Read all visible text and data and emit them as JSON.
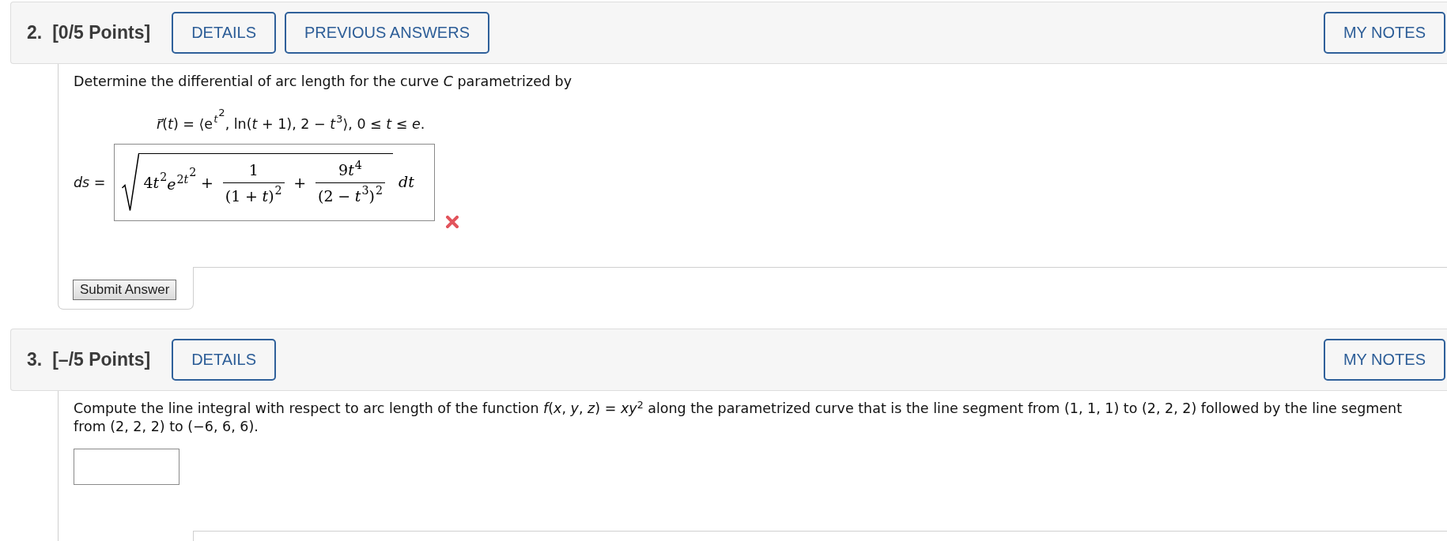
{
  "problems": [
    {
      "number": "2.",
      "points": "[0/5 Points]",
      "buttons": [
        "DETAILS",
        "PREVIOUS ANSWERS"
      ],
      "notes_button": "MY NOTES",
      "question": "Determine the differential of arc length for the curve *C* parametrized by",
      "equation": [
        {
          "kind": "italic",
          "text": "r⃗"
        },
        {
          "kind": "upright",
          "text": "("
        },
        {
          "kind": "italic",
          "text": "t"
        },
        {
          "kind": "upright",
          "text": ") = ⟨"
        },
        {
          "kind": "sup",
          "base": [
            {
              "kind": "upright",
              "text": "e"
            }
          ],
          "sup": [
            {
              "kind": "sup",
              "base": [
                {
                  "kind": "italic",
                  "text": "t"
                }
              ],
              "sup": [
                {
                  "kind": "upright",
                  "text": "2"
                }
              ]
            }
          ]
        },
        {
          "kind": "upright",
          "text": ", ln("
        },
        {
          "kind": "italic",
          "text": "t"
        },
        {
          "kind": "upright",
          "text": " + 1), 2 − "
        },
        {
          "kind": "sup",
          "base": [
            {
              "kind": "italic",
              "text": "t"
            }
          ],
          "sup": [
            {
              "kind": "upright",
              "text": "3"
            }
          ]
        },
        {
          "kind": "upright",
          "text": "⟩, 0 ≤ "
        },
        {
          "kind": "italic",
          "text": "t"
        },
        {
          "kind": "upright",
          "text": " ≤ "
        },
        {
          "kind": "italic",
          "text": "e"
        },
        {
          "kind": "upright",
          "text": "."
        }
      ],
      "answer": {
        "kind": "math",
        "label": "*ds* =",
        "radicand": [
          {
            "kind": "upright",
            "text": "4"
          },
          {
            "kind": "sup",
            "base": [
              {
                "kind": "italic",
                "text": "t"
              }
            ],
            "sup": [
              {
                "kind": "upright",
                "text": "2"
              }
            ]
          },
          {
            "kind": "sup",
            "base": [
              {
                "kind": "italic",
                "text": "e"
              }
            ],
            "sup": [
              {
                "kind": "upright",
                "text": "2"
              },
              {
                "kind": "sup",
                "base": [
                  {
                    "kind": "italic",
                    "text": "t"
                  }
                ],
                "sup": [
                  {
                    "kind": "upright",
                    "text": "2"
                  }
                ]
              }
            ]
          },
          {
            "kind": "op",
            "text": "+"
          },
          {
            "kind": "frac",
            "num": [
              {
                "kind": "upright",
                "text": "1"
              }
            ],
            "den": [
              {
                "kind": "upright",
                "text": "(1"
              },
              {
                "kind": "op",
                "text": "+"
              },
              {
                "kind": "italic",
                "text": "t"
              },
              {
                "kind": "sup",
                "base": [
                  {
                    "kind": "upright",
                    "text": ")"
                  }
                ],
                "sup": [
                  {
                    "kind": "upright",
                    "text": "2"
                  }
                ]
              }
            ]
          },
          {
            "kind": "op",
            "text": "+"
          },
          {
            "kind": "frac",
            "num": [
              {
                "kind": "upright",
                "text": "9"
              },
              {
                "kind": "sup",
                "base": [
                  {
                    "kind": "italic",
                    "text": "t"
                  }
                ],
                "sup": [
                  {
                    "kind": "upright",
                    "text": "4"
                  }
                ]
              }
            ],
            "den": [
              {
                "kind": "upright",
                "text": "(2"
              },
              {
                "kind": "op",
                "text": "−"
              },
              {
                "kind": "sup",
                "base": [
                  {
                    "kind": "italic",
                    "text": "t"
                  }
                ],
                "sup": [
                  {
                    "kind": "upright",
                    "text": "3"
                  }
                ]
              },
              {
                "kind": "sup",
                "base": [
                  {
                    "kind": "upright",
                    "text": ")"
                  }
                ],
                "sup": [
                  {
                    "kind": "upright",
                    "text": "2"
                  }
                ]
              }
            ]
          }
        ],
        "differential": "dt",
        "correct": false
      },
      "submit_button": "Submit Answer"
    },
    {
      "number": "3.",
      "points": "[–/5 Points]",
      "buttons": [
        "DETAILS"
      ],
      "notes_button": "MY NOTES",
      "question": "Compute the line integral with respect to arc length of the function *f*(*x*, *y*, *z*) = *xy*$^{2}$ along the parametrized curve that is the line segment from (1, 1, 1) to (2, 2, 2) followed by the line segment from (2, 2, 2) to (−6, 6, 6).",
      "answer": {
        "kind": "text_field"
      }
    }
  ]
}
